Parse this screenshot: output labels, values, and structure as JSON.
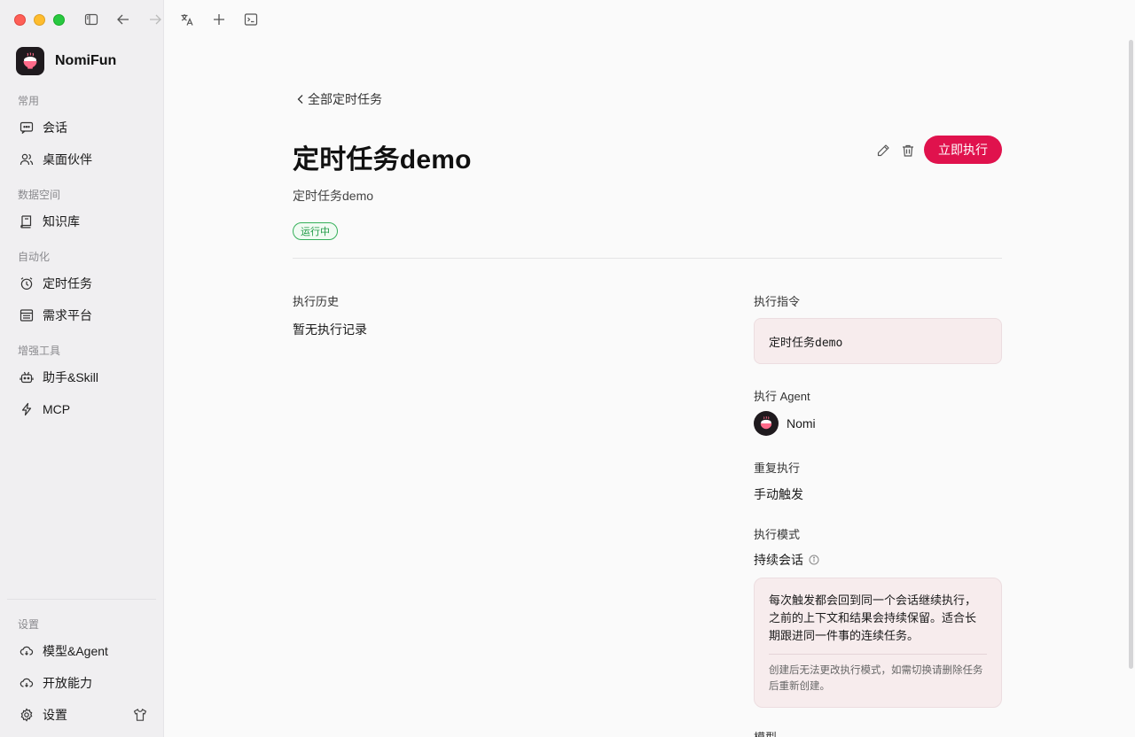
{
  "app": {
    "name": "NomiFun",
    "logo_icon": "rice-bowl-logo-icon"
  },
  "titlebar": {
    "icons": [
      "sidebar-toggle-icon",
      "back-arrow-icon",
      "forward-arrow-icon",
      "translate-icon",
      "plus-icon",
      "terminal-icon"
    ]
  },
  "sidebar": {
    "sections": {
      "common": "常用",
      "data": "数据空间",
      "automation": "自动化",
      "tools": "增强工具",
      "settings": "设置"
    },
    "items": {
      "chat": "会话",
      "desk_partner": "桌面伙伴",
      "knowledge": "知识库",
      "scheduled": "定时任务",
      "demand": "需求平台",
      "assistant_skill": "助手&Skill",
      "mcp": "MCP",
      "model_agent": "模型&Agent",
      "open_ability": "开放能力",
      "settings": "设置"
    }
  },
  "page": {
    "back_label": "全部定时任务",
    "title": "定时任务demo",
    "subtitle": "定时任务demo",
    "status": "运行中",
    "run_button": "立即执行"
  },
  "history": {
    "label": "执行历史",
    "empty": "暂无执行记录"
  },
  "details": {
    "instruction_label": "执行指令",
    "instruction_value": "定时任务demo",
    "agent_label": "执行 Agent",
    "agent_name": "Nomi",
    "repeat_label": "重复执行",
    "repeat_value": "手动触发",
    "mode_label": "执行模式",
    "mode_value": "持续会话",
    "mode_desc": "每次触发都会回到同一个会话继续执行，之前的上下文和结果会持续保留。适合长期跟进同一件事的连续任务。",
    "mode_note": "创建后无法更改执行模式，如需切换请删除任务后重新创建。",
    "model_label": "模型"
  },
  "colors": {
    "accent": "#e0124d",
    "status_green": "#1f9a44",
    "sidebar_bg": "#f0eff1",
    "main_bg": "#fafafa",
    "box_bg": "#f7eced"
  }
}
